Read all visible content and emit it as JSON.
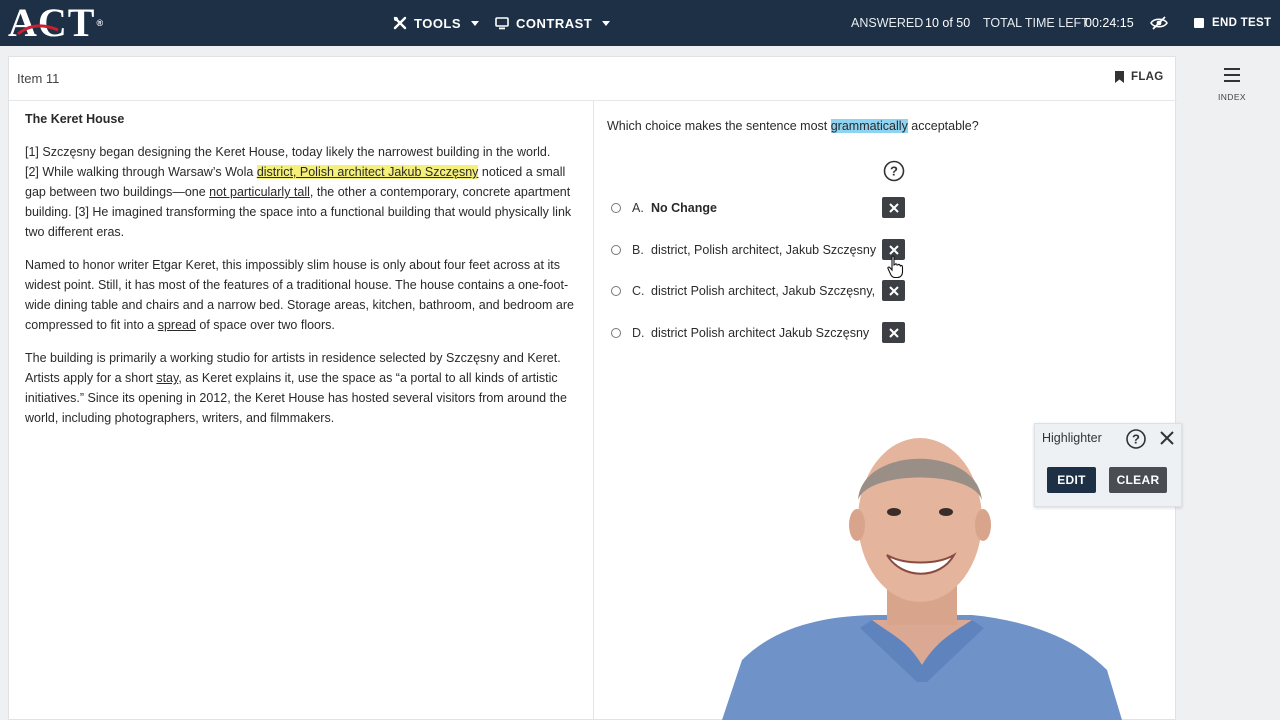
{
  "app": {
    "logo_text": "ACT",
    "logo_reg": "®"
  },
  "topbar": {
    "tools_label": "TOOLS",
    "contrast_label": "CONTRAST",
    "answered_label": "ANSWERED",
    "answered_value": "10 of 50",
    "time_label": "TOTAL TIME LEFT",
    "time_value": "00:24:15",
    "end_test_label": "END TEST"
  },
  "item": {
    "label": "Item 11",
    "flag_label": "FLAG"
  },
  "passage": {
    "title": "The Keret House",
    "p1": {
      "line1": "[1] Szczęsny began designing the Keret House, today likely the narrowest building in the world.",
      "pre": "[2] While walking through Warsaw’s Wola ",
      "highlight": "district, Polish architect Jakub Szczęsny",
      "mid": " noticed a small gap between two buildings—one ",
      "underlined": "not particularly tall",
      "post": ", the other a contemporary, concrete apartment building. [3] He imagined transforming the space into a functional building that would physically link two different eras."
    },
    "p2": {
      "pre": "Named to honor writer Etgar Keret, this impossibly slim house is only about four feet across at its widest point. Still, it has most of the features of a traditional house. The house contains a one-foot-wide dining table and chairs and a narrow bed. Storage areas, kitchen, bathroom, and bedroom are compressed to fit into a ",
      "underlined": "spread",
      "post": " of space over two floors."
    },
    "p3": {
      "pre": "The building is primarily a working studio for artists in residence selected by Szczęsny and Keret. Artists apply for a short ",
      "underlined": "stay",
      "post": ", as Keret explains it, use the space as “a portal to all kinds of artistic initiatives.” Since its opening in 2012, the Keret House has hosted several visitors from around the world, including photographers, writers, and filmmakers."
    }
  },
  "question": {
    "pre": "Which choice makes the sentence most ",
    "highlight": "grammatically",
    "post": " acceptable?",
    "choices": [
      {
        "letter": "A.",
        "text": "No Change"
      },
      {
        "letter": "B.",
        "text": "district, Polish architect, Jakub Szczęsny"
      },
      {
        "letter": "C.",
        "text": "district Polish architect, Jakub Szczęsny,"
      },
      {
        "letter": "D.",
        "text": "district Polish architect Jakub Szczęsny"
      }
    ]
  },
  "index": {
    "label": "INDEX"
  },
  "highlighter": {
    "title": "Highlighter",
    "edit_label": "EDIT",
    "clear_label": "CLEAR"
  },
  "colors": {
    "topbar_bg": "#1d3046",
    "highlight_yellow": "#f5f07a",
    "highlight_blue": "#8fd3f2",
    "eliminate_btn": "#3c3f44"
  }
}
